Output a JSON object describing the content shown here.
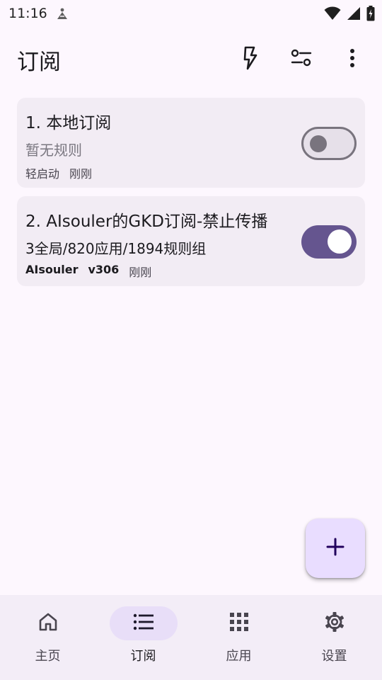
{
  "status_bar": {
    "time": "11:16",
    "icons": [
      "notification-icon",
      "wifi-icon",
      "signal-icon",
      "battery-charging-icon"
    ]
  },
  "top_bar": {
    "title": "订阅",
    "actions": [
      "flash-icon",
      "filter-icon",
      "more-vert-icon"
    ]
  },
  "subscriptions": [
    {
      "title": "1. 本地订阅",
      "subtitle": "暂无规则",
      "meta": [
        "轻启动",
        "刚刚"
      ],
      "enabled": false
    },
    {
      "title": "2. AIsouler的GKD订阅-禁止传播",
      "subtitle": "3全局/820应用/1894规则组",
      "meta": [
        "AIsouler",
        "v306",
        "刚刚"
      ],
      "enabled": true
    }
  ],
  "fab": {
    "icon": "add-icon"
  },
  "bottom_nav": {
    "items": [
      {
        "label": "主页",
        "icon": "home-icon",
        "active": false
      },
      {
        "label": "订阅",
        "icon": "list-icon",
        "active": true
      },
      {
        "label": "应用",
        "icon": "apps-grid-icon",
        "active": false
      },
      {
        "label": "设置",
        "icon": "settings-icon",
        "active": false
      }
    ]
  },
  "colors": {
    "background": "#fdf7fe",
    "card": "#f2ecf4",
    "switch_on": "#65558f",
    "fab": "#e9ddff",
    "nav_active_pill": "#e8def8",
    "nav_bar": "#f3edf7"
  }
}
